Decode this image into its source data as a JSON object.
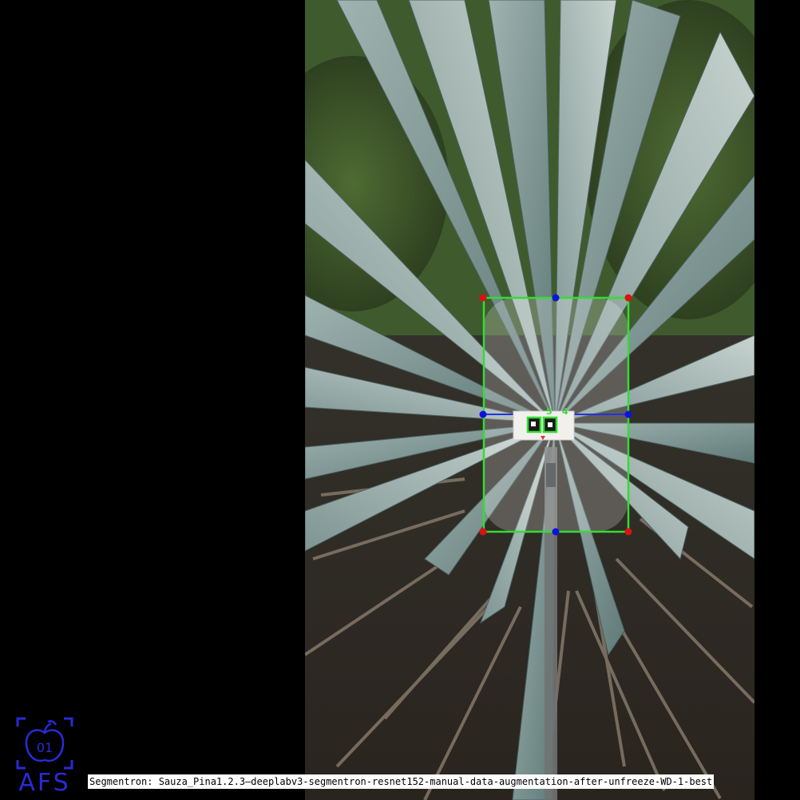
{
  "caption": "Segmentron: Sauza_Pina1.2.3—deeplabv3-segmentron-resnet152-manual-data-augmentation-after-unfreeze-WD-1-best",
  "logo": {
    "text": "AFS",
    "badge_text": "01",
    "icon": "apple-icon",
    "color": "#2a2ad8"
  },
  "overlay": {
    "bbox_color": "#33dd33",
    "corner_point_color": "#dd1111",
    "mid_point_color": "#1111dd",
    "axis_line_color": "#2233dd",
    "marker_labels": [
      "5",
      "4"
    ]
  }
}
